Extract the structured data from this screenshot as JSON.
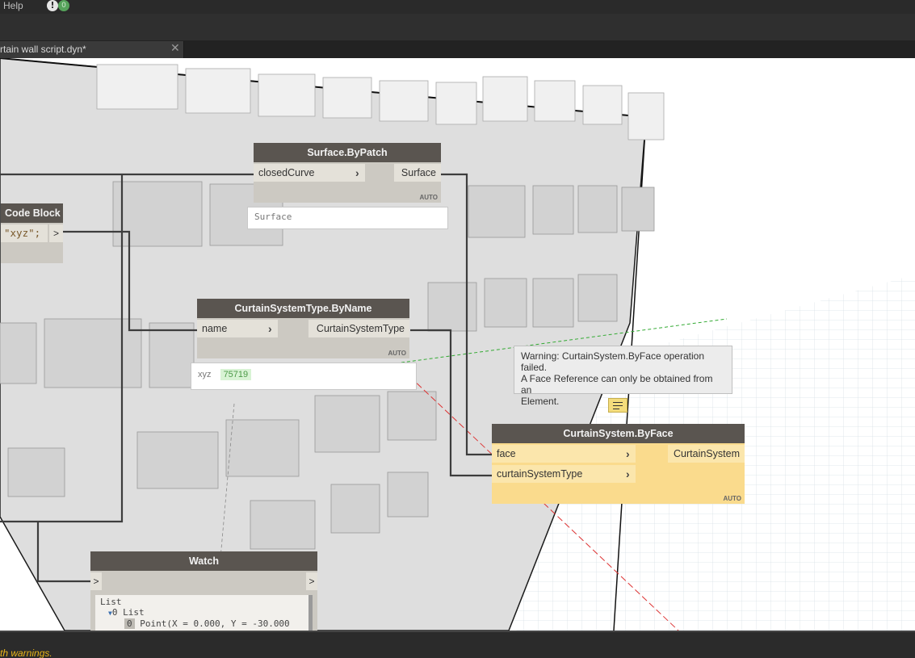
{
  "menubar": {
    "help_label": "Help",
    "notification_count": "0"
  },
  "tab": {
    "title": "rtain wall script.dyn*",
    "close_glyph": "✕"
  },
  "nodes": {
    "surface_by_patch": {
      "title": "Surface.ByPatch",
      "input": "closedCurve",
      "output": "Surface",
      "lacing": "AUTO",
      "preview": "Surface"
    },
    "code_block": {
      "title": "Code Block",
      "code": "\"xyz\";",
      "output_glyph": ">"
    },
    "curtain_type": {
      "title": "CurtainSystemType.ByName",
      "input": "name",
      "output": "CurtainSystemType",
      "lacing": "AUTO",
      "preview_name": "xyz",
      "preview_id": "75719"
    },
    "curtain_system": {
      "title": "CurtainSystem.ByFace",
      "input1": "face",
      "input2": "curtainSystemType",
      "output": "CurtainSystem",
      "lacing": "AUTO",
      "warning_line1": "Warning: CurtainSystem.ByFace operation failed.",
      "warning_line2": "A Face Reference can only be obtained from an",
      "warning_line3": "Element."
    },
    "watch": {
      "title": "Watch",
      "in_glyph": ">",
      "out_glyph": ">",
      "line1": "List",
      "line2": "0 List",
      "line3_index": "0",
      "line3_value": "Point(X = 0.000, Y = -30.000"
    }
  },
  "status": {
    "message": "th warnings."
  },
  "colors": {
    "node_header": "#5a5550",
    "warning_body": "#fadb8d",
    "status_text": "#e8b41a"
  }
}
